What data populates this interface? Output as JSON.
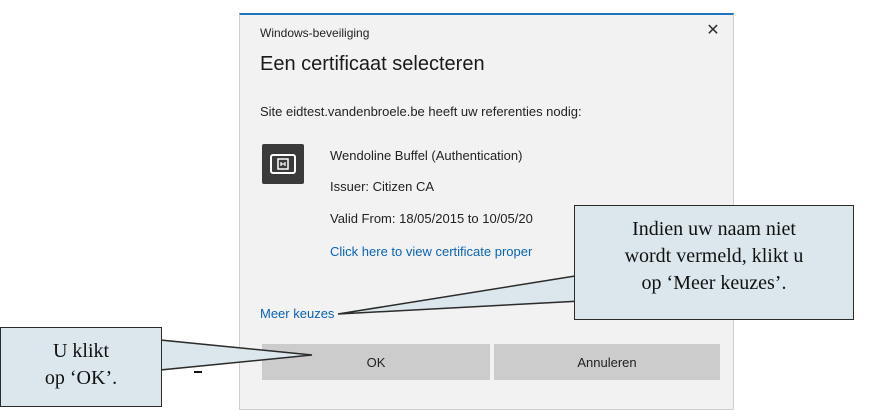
{
  "dialog": {
    "window_title": "Windows-beveiliging",
    "close_glyph": "✕",
    "heading": "Een certificaat selecteren",
    "subtext": "Site eidtest.vandenbroele.be heeft uw referenties nodig:",
    "certificate": {
      "icon": "certificate-card-icon",
      "name": "Wendoline Buffel (Authentication)",
      "issuer": "Issuer: Citizen CA",
      "valid": "Valid From: 18/05/2015 to 10/05/20",
      "link": "Click here to view certificate proper"
    },
    "more_choices": "Meer keuzes",
    "ok_label": "OK",
    "cancel_label": "Annuleren"
  },
  "callouts": {
    "right": [
      "Indien uw naam niet",
      "wordt vermeld, klikt u",
      "op ‘Meer keuzes’."
    ],
    "left": [
      "U klikt",
      "op ‘OK’."
    ]
  },
  "colors": {
    "accent": "#1e73be",
    "link": "#0a64b6",
    "callout_fill": "#dbe7ec",
    "button": "#cccccc"
  }
}
